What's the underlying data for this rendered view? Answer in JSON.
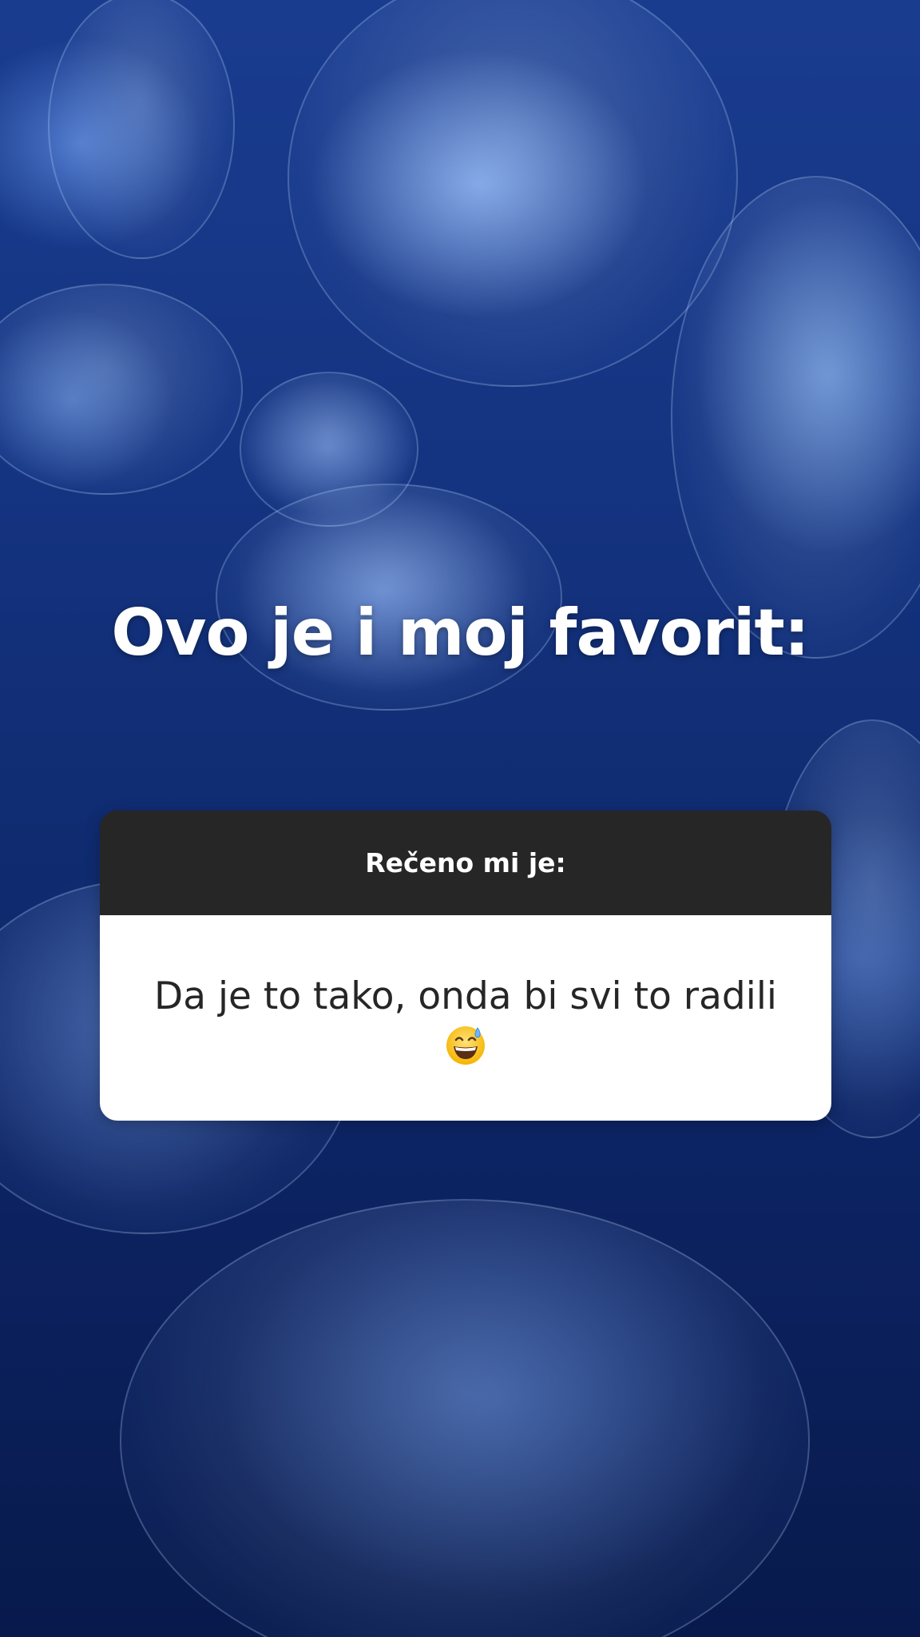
{
  "story": {
    "background": "jellyfish-underwater-photo",
    "accent_colors": {
      "deep_blue": "#0c2260",
      "light_blue": "#96beff"
    },
    "headline": "Ovo je i moj favorit:",
    "question_box": {
      "prompt": "Rečeno mi je:",
      "answer": "Da je to tako, onda bi svi to radili",
      "emoji": "grinning-face-with-sweat-icon",
      "header_color": "#262626",
      "body_color": "#ffffff"
    }
  }
}
